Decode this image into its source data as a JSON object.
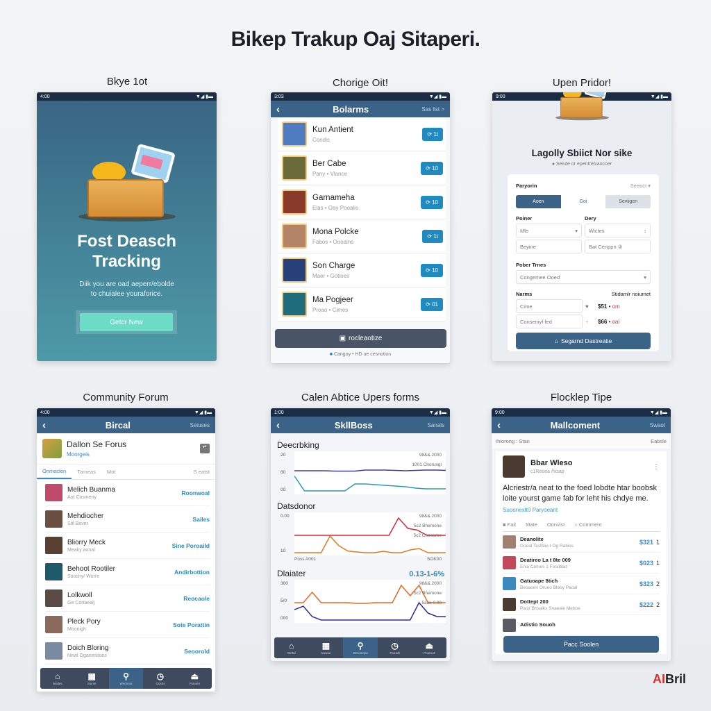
{
  "page_title": "Bikep Trakup Oaj Sitaperi.",
  "logo": {
    "mark": "AI",
    "text": "Bril"
  },
  "colors": {
    "header": "#3b6388",
    "statusbar": "#1b2d44",
    "accent": "#1f8bc0",
    "cta_teal": "#6ddcc6"
  },
  "status_time": [
    "4:00",
    "3:03",
    "9:00",
    "4:00",
    "1:00",
    "9:00"
  ],
  "onboarding": {
    "label": "Bkye 1ot",
    "title_line1": "Fost Deasch",
    "title_line2": "Tracking",
    "subtitle_line1": "Diik you are oad aeperr/ebolde",
    "subtitle_line2": "to chuialee youraforice.",
    "cta": "Getcr New"
  },
  "list_screen": {
    "label": "Chorige Oit!",
    "header_title": "Bolarms",
    "header_action": "Sas list >",
    "items": [
      {
        "name": "Kun Antient",
        "sub": "Condis",
        "badge": "1t",
        "color": "#4f7cc0"
      },
      {
        "name": "Ber Cabe",
        "sub": "Pany • Vlance",
        "badge": "10",
        "color": "#6b6a3a"
      },
      {
        "name": "Garnameha",
        "sub": "Elas • Oay Pooalis",
        "badge": "10",
        "color": "#8a3a2a"
      },
      {
        "name": "Mona Polcke",
        "sub": "Fabos • Oooains",
        "badge": "1t",
        "color": "#b48468"
      },
      {
        "name": "Son Charge",
        "sub": "Maer • Gotioes",
        "badge": "10",
        "color": "#28417a"
      },
      {
        "name": "Ma Pogjeer",
        "sub": "Proao • Cimes",
        "badge": "01",
        "color": "#1e6c7c"
      }
    ],
    "bottom_button": "rocleaotize",
    "footer": "Cangoy • HD ue cesnotion"
  },
  "form_screen": {
    "label": "Upen Pridor!",
    "title": "Lagolly Sbiict Nor sike",
    "subtitle": "Seiute or epentrelvaocoer",
    "section": "Paryorin",
    "select_label": "Seeoct ▾",
    "segments": [
      "Aoen",
      "Goi",
      "Seviigen"
    ],
    "field1_label": "Poiner",
    "field2_label": "Dery",
    "field1_value": "Mle",
    "field2_value": "Wictes",
    "field3_placeholder": "Beyine",
    "field4_placeholder": "Bat Cenppn ③",
    "time_label": "Pober Trnes",
    "time_value": "Congemee Ooed",
    "names_label": "Narms",
    "amount_label": "Stidamlr noiumet",
    "name1": "Cime",
    "name2": "Conseniyf fed",
    "price1": "$51",
    "price1_tag": "om",
    "price2": "$66",
    "price2_tag": "oai",
    "cta": "Segarnd Dastreatie"
  },
  "forum": {
    "label": "Community Forum",
    "header_title": "Bircal",
    "header_action": "Seiuses",
    "forum_name": "Dallon Se Forus",
    "forum_sub": "Moorgeis",
    "tabs": [
      "Onmoclen",
      "Tarneas",
      "Mot",
      "S eatst"
    ],
    "items": [
      {
        "name": "Melich Buanma",
        "sub": "Aot Cosmeny",
        "link": "Roonwoal",
        "color": "#c04a6a"
      },
      {
        "name": "Mehdiocher",
        "sub": "Stil Bover",
        "link": "Sailes",
        "color": "#6a5040"
      },
      {
        "name": "Bliorry Meck",
        "sub": "Meaky aonal",
        "link": "Sine Poroaild",
        "color": "#5a4030"
      },
      {
        "name": "Behoot Rootiler",
        "sub": "Sooshy/ Worre",
        "link": "Andirbottion",
        "color": "#1e5a6a"
      },
      {
        "name": "Lolkwoll",
        "sub": "Ge Cortaealj",
        "link": "Reocaole",
        "color": "#5a4a44"
      },
      {
        "name": "Pleck Pory",
        "sub": "Moonigh",
        "link": "Sote Porattin",
        "color": "#8a6a5a"
      },
      {
        "name": "Doich Bloring",
        "sub": "Newl Oganestioes",
        "link": "Seoorold",
        "color": "#7a8aa0"
      }
    ],
    "nav": [
      "Wodes",
      "Siurse",
      "Weornos",
      "Ooiols",
      "Ponoen"
    ]
  },
  "stats": {
    "label": "Calen Abtice Upers forms",
    "header_title": "SkllBoss",
    "header_action": "Sanals",
    "charts": [
      {
        "title": "Deecrbking",
        "y_ticks": [
          "20",
          "60",
          "00"
        ],
        "legend": [
          "98&&.2000",
          "1001 Chorungi"
        ],
        "footer": [],
        "series": [
          {
            "color": "#3d3fa0",
            "values": [
              60,
              60,
              60,
              60,
              59,
              59,
              59,
              62,
              62,
              62,
              61,
              60,
              61,
              62,
              62,
              61
            ]
          },
          {
            "color": "#2a9ab0",
            "values": [
              45,
              2,
              2,
              2,
              2,
              2,
              22,
              22,
              20,
              18,
              16,
              14,
              10,
              8,
              8,
              8
            ]
          }
        ]
      },
      {
        "title": "Datsdonor",
        "y_ticks": [
          "0.00",
          "10"
        ],
        "legend": [
          "98&&.2000",
          "5c2 Bhemone",
          "5c2 Chosorne"
        ],
        "footer": [
          "Poss A001",
          "SOK00"
        ],
        "series": [
          {
            "color": "#d02a3a",
            "values": [
              50,
              50,
              50,
              50,
              50,
              50,
              50,
              50,
              50,
              50,
              50,
              100,
              70,
              65,
              50,
              50,
              50
            ]
          },
          {
            "color": "#e07a20",
            "values": [
              0,
              0,
              0,
              0,
              48,
              20,
              5,
              2,
              0,
              0,
              4,
              0,
              0,
              8,
              12,
              0,
              0,
              0
            ]
          }
        ]
      },
      {
        "title": "Dlaiater",
        "headline": "0.13-1-6%",
        "y_ticks": [
          "300",
          "5/0",
          "000"
        ],
        "legend": [
          "98&&.2000",
          "5c2 Bhemone",
          "5aak 0.00"
        ],
        "footer": [],
        "series": [
          {
            "color": "#e06a20",
            "values": [
              50,
              50,
              80,
              50,
              50,
              50,
              50,
              48,
              48,
              50,
              50,
              50,
              100,
              70,
              100,
              50,
              50,
              50
            ]
          },
          {
            "color": "#2a2a9a",
            "values": [
              30,
              40,
              10,
              0,
              0,
              0,
              0,
              0,
              0,
              0,
              0,
              0,
              0,
              0,
              50,
              20,
              10,
              10
            ]
          }
        ]
      }
    ],
    "nav": [
      "Strttal",
      "Nuwae",
      "Weromope",
      "Pioradt",
      "Pooraut"
    ]
  },
  "feed": {
    "label": "Flocklep Tipe",
    "header_title": "Mallcoment",
    "header_action": "Swaot",
    "sub_left": "Ihiorong : Stan",
    "sub_right": "Eabsle",
    "author": "Bbar Wleso",
    "handle": "c1Reoea /hisap",
    "post": "Alcriestr/a neat to the foed lobdte htar boobsk loite yourst game fab for leht his chdye me.",
    "post_link": "Suoonextt0 Paryoeant",
    "actions": [
      "Fait",
      "Mate",
      "Oonvist",
      "Comment"
    ],
    "items": [
      {
        "name": "Deanolite",
        "sub": "Goeal Teslfeie t Og Rabiss",
        "price": "$321",
        "qty": "1",
        "color": "#a08070"
      },
      {
        "name": "Deatireo La t 8te 009",
        "sub": "Enoi Cemes 1 Foodiiad",
        "price": "$023",
        "qty": "1",
        "color": "#c04a5a"
      },
      {
        "name": "Gatuoape 8tich",
        "sub": "Beoaoen Orueo Blaoy Paoal",
        "price": "$323",
        "qty": "2",
        "color": "#3a8ac0"
      },
      {
        "name": "Dottept 200",
        "sub": "Paoz Bhsaiks Snaeale Meboe",
        "price": "$222",
        "qty": "2",
        "color": "#4a3a30"
      },
      {
        "name": "Adistio Souoh",
        "sub": "",
        "price": "",
        "qty": "",
        "color": "#5a5a66"
      }
    ],
    "cta": "Pacc Soolen"
  }
}
